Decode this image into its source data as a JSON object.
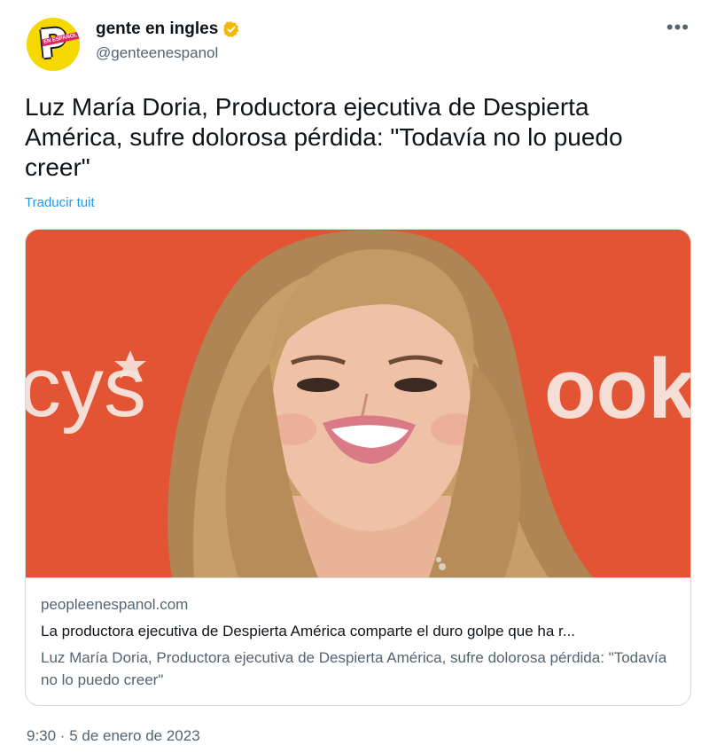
{
  "author": {
    "display_name": "gente en ingles",
    "handle": "@genteenespanol",
    "avatar_icon": "people-en-espanol-logo-icon",
    "avatar_tag": "EN ESPAÑOL",
    "verified_icon": "verified-badge-icon",
    "verified_color": "#f5b800"
  },
  "more_icon": "more-options-icon",
  "more_label": "•••",
  "tweet": {
    "text": "Luz María Doria, Productora ejecutiva de Despierta América, sufre dolorosa pérdida: \"Todavía no lo puedo creer\"",
    "translate_label": "Traducir tuit"
  },
  "card": {
    "image_bg_left": "cys",
    "image_bg_right": "ook",
    "image_bg_color": "#e25434",
    "domain": "peopleenespanol.com",
    "description": "La productora ejecutiva de Despierta América comparte el duro golpe que ha r...",
    "title": "Luz María Doria, Productora ejecutiva de Despierta América, sufre dolorosa pérdida: \"Todavía no lo puedo creer\""
  },
  "timestamp": "9:30 · 5 de enero de 2023",
  "colors": {
    "link": "#1d9bf0",
    "secondary_text": "#536471",
    "primary_text": "#0f1419",
    "border": "#cfd9de"
  }
}
